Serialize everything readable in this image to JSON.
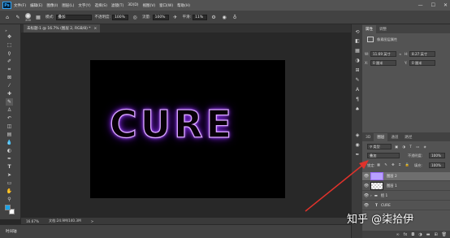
{
  "menubar": {
    "logo": "Ps",
    "items": [
      "文件(F)",
      "编辑(E)",
      "图像(I)",
      "图层(L)",
      "文字(Y)",
      "选择(S)",
      "滤镜(T)",
      "3D(D)",
      "视图(V)",
      "窗口(W)",
      "帮助(H)"
    ],
    "window_controls": [
      "—",
      "☐",
      "✕"
    ]
  },
  "options": {
    "brush_size": "200",
    "mode_label": "模式:",
    "mode_value": "叠加",
    "opacity_label": "不透明度:",
    "opacity_value": "100%",
    "flow_label": "流量:",
    "flow_value": "100%",
    "smooth_label": "平滑:",
    "smooth_value": "11%"
  },
  "document": {
    "tab_title": "未标题-1 @ 16.7% (图层 2, RGB/8) *",
    "tab_close": "×",
    "canvas_text": "CURE"
  },
  "status": {
    "zoom": "16.67%",
    "doc_info": "文档:24.9M/140.3M",
    "arrow": ">"
  },
  "timeline": {
    "label": "时间轴"
  },
  "properties": {
    "tabs": [
      "属性",
      "调整"
    ],
    "heading": "像素图层属性",
    "w_label": "W:",
    "w_value": "11.69 英寸",
    "h_label": "H:",
    "h_value": "8.27 英寸",
    "x_label": "X:",
    "x_value": "0 厘米",
    "y_label": "Y:",
    "y_value": "0 厘米"
  },
  "layers_panel": {
    "tabs": [
      "3D",
      "图层",
      "通道",
      "路径"
    ],
    "filter_label": "类型",
    "blend_mode": "叠加",
    "opacity_label": "不透明度:",
    "opacity_value": "100%",
    "lock_label": "锁定:",
    "fill_label": "填充:",
    "fill_value": "100%",
    "layers": [
      {
        "name": "图层 2",
        "visible": true,
        "selected": true
      },
      {
        "name": "图层 1",
        "visible": true,
        "selected": false
      },
      {
        "name": "组 1",
        "visible": true,
        "selected": false,
        "group": true
      },
      {
        "name": "CURE",
        "visible": true,
        "selected": false,
        "text": true
      }
    ]
  },
  "watermark": "知乎 @柒拾伊",
  "colors": {
    "foreground": "#1aa3e8",
    "background": "#ffffff",
    "glow": "#b35cff",
    "annotation_arrow": "#e0322b"
  }
}
